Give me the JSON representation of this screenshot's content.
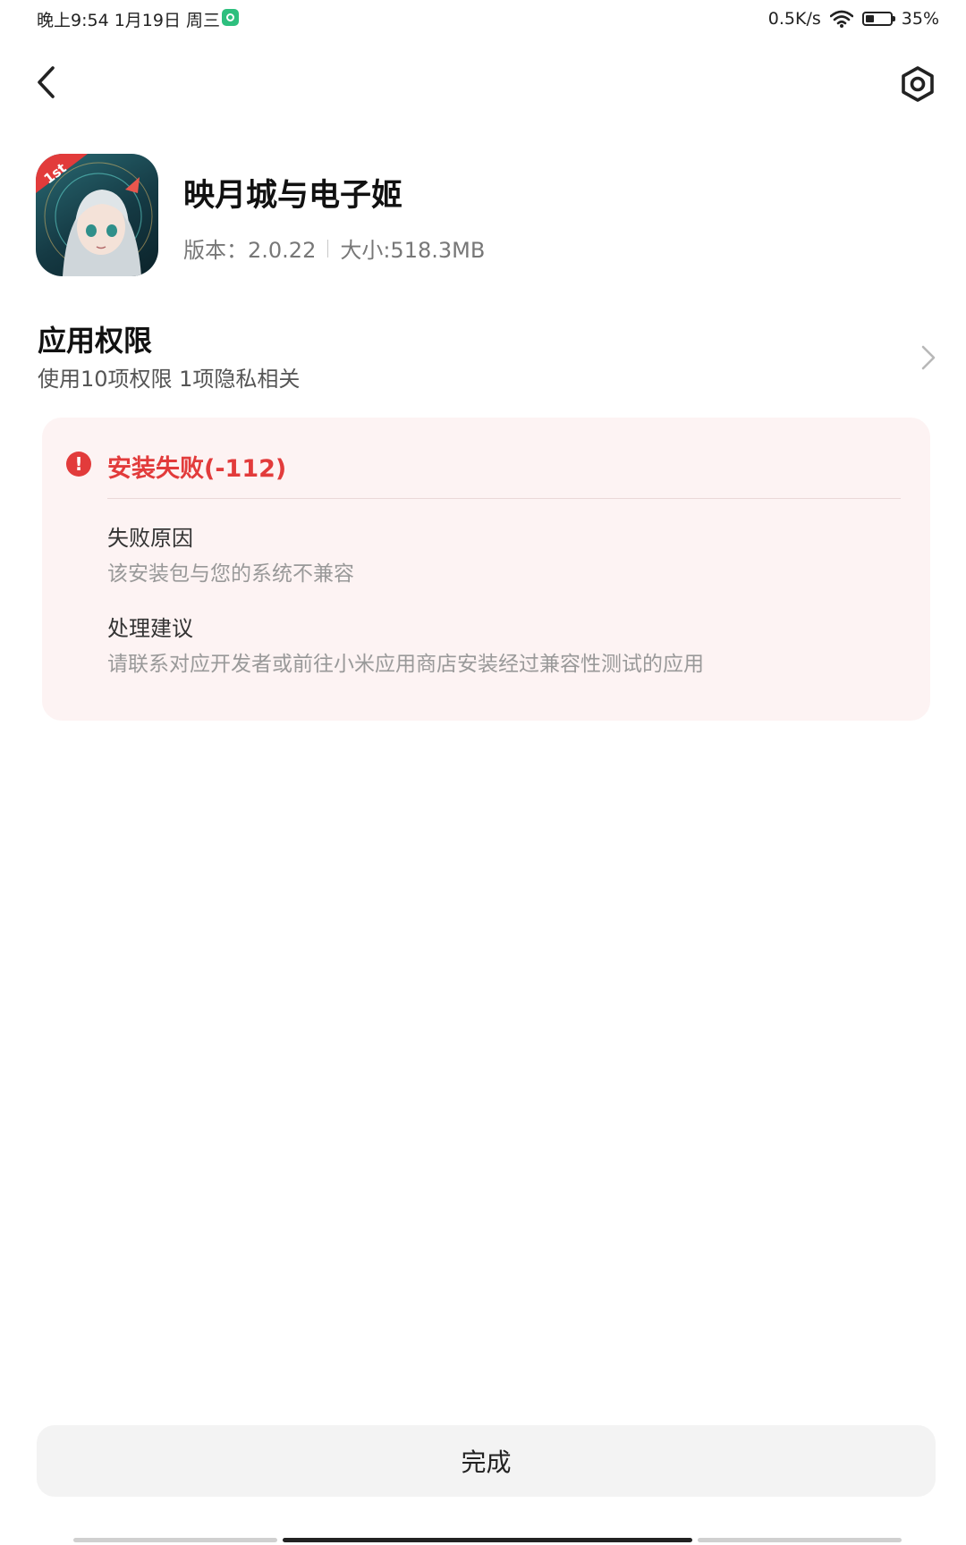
{
  "status_bar": {
    "time": "晚上9:54  1月19日 周三",
    "net_speed": "0.5K/s",
    "battery": "35%"
  },
  "nav": {
    "back_icon": "back-arrow-icon",
    "settings_icon": "settings-hexagon-icon"
  },
  "app": {
    "name": "映月城与电子姬",
    "version": "版本：2.0.22",
    "size": "大小:518.3MB",
    "icon_badge": "1st"
  },
  "permissions": {
    "title": "应用权限",
    "subtitle": "使用10项权限 1项隐私相关"
  },
  "error": {
    "icon": "!",
    "title": "安装失败(-112)",
    "reason_label": "失败原因",
    "reason_text": "该安装包与您的系统不兼容",
    "suggestion_label": "处理建议",
    "suggestion_text": "请联系对应开发者或前往小米应用商店安装经过兼容性测试的应用",
    "accent_color": "#e23b3b",
    "card_color": "#fdf3f3"
  },
  "footer": {
    "done_label": "完成"
  }
}
